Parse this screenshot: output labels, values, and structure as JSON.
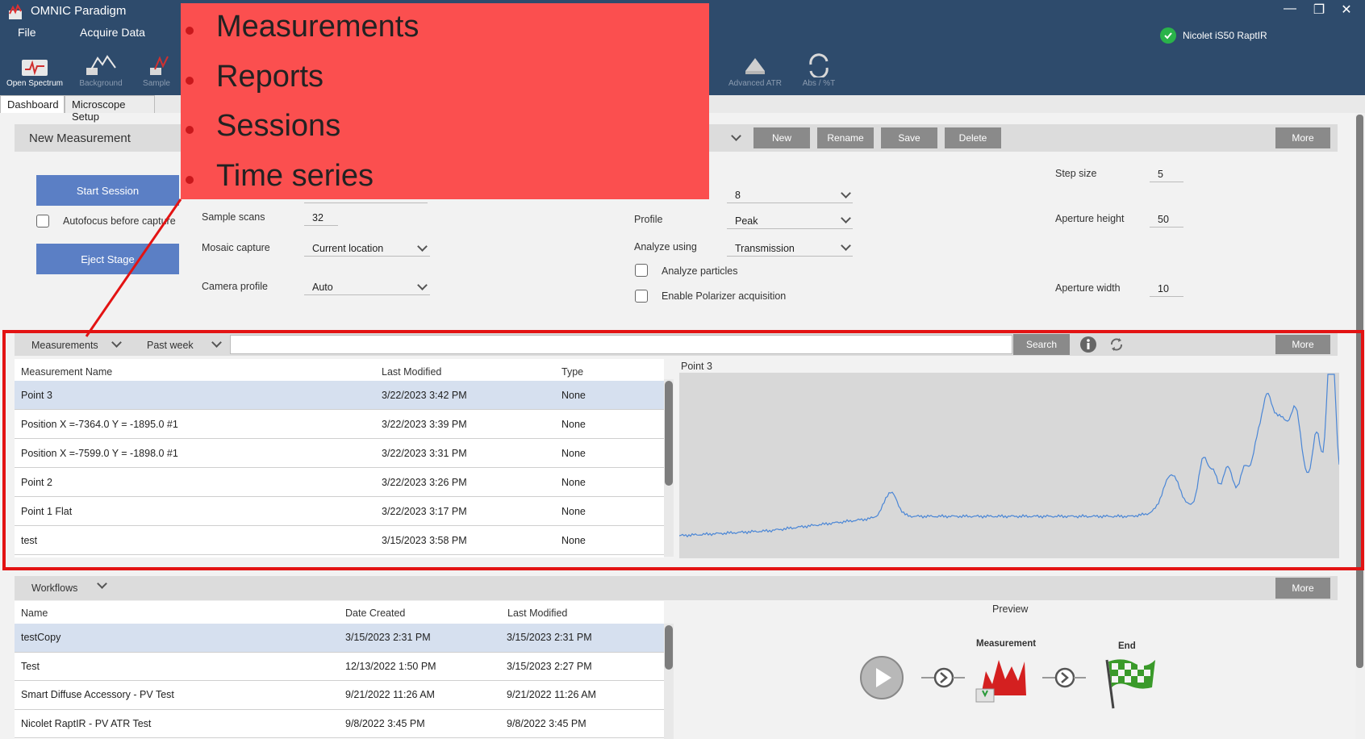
{
  "app": {
    "title": "OMNIC Paradigm"
  },
  "window_controls": {
    "minimize": "—",
    "restore": "❐",
    "close": "✕"
  },
  "menu": {
    "file": "File",
    "acquire": "Acquire Data"
  },
  "instrument": {
    "name": "Nicolet iS50 RaptIR",
    "status_color": "#2ab34a"
  },
  "toolbar": {
    "open_spectrum": "Open Spectrum",
    "background": "Background",
    "sample": "Sample",
    "advanced_atr": "Advanced ATR",
    "abs_t": "Abs / %T"
  },
  "tabs": {
    "dashboard": "Dashboard",
    "microscope": "Microscope Setup"
  },
  "new_measurement": {
    "title": "New Measurement",
    "buttons": {
      "new": "New",
      "rename": "Rename",
      "save": "Save",
      "delete": "Delete",
      "more": "More"
    },
    "start_session": "Start Session",
    "eject_stage": "Eject Stage",
    "autofocus_label": "Autofocus before capture",
    "sample_scans_label": "Sample scans",
    "sample_scans_value": "32",
    "mosaic_label": "Mosaic capture",
    "mosaic_value": "Current location",
    "camera_label": "Camera profile",
    "camera_value": "Auto",
    "top_select_value": "8",
    "profile_label": "Profile",
    "profile_value": "Peak",
    "analyze_label": "Analyze using",
    "analyze_value": "Transmission",
    "analyze_particles_label": "Analyze particles",
    "polarizer_label": "Enable Polarizer acquisition",
    "step_size_label": "Step size",
    "step_size_value": "5",
    "aperture_height_label": "Aperture height",
    "aperture_height_value": "50",
    "aperture_width_label": "Aperture width",
    "aperture_width_value": "10"
  },
  "measurements": {
    "scope_select": "Measurements",
    "time_select": "Past week",
    "search_button": "Search",
    "more": "More",
    "columns": [
      "Measurement Name",
      "Last Modified",
      "Type"
    ],
    "rows": [
      [
        "Point 3",
        "3/22/2023 3:42 PM",
        "None"
      ],
      [
        "Position X =-7364.0 Y = -1895.0 #1",
        "3/22/2023 3:39 PM",
        "None"
      ],
      [
        "Position X =-7599.0 Y = -1898.0 #1",
        "3/22/2023 3:31 PM",
        "None"
      ],
      [
        "Point 2",
        "3/22/2023 3:26 PM",
        "None"
      ],
      [
        "Point 1 Flat",
        "3/22/2023 3:17 PM",
        "None"
      ],
      [
        "test",
        "3/15/2023 3:58 PM",
        "None"
      ]
    ],
    "preview_title": "Point 3",
    "spectrum_color": "#4a86d6"
  },
  "workflows": {
    "select": "Workflows",
    "more": "More",
    "columns": [
      "Name",
      "Date Created",
      "Last Modified"
    ],
    "rows": [
      [
        "testCopy",
        "3/15/2023 2:31 PM",
        "3/15/2023 2:31 PM"
      ],
      [
        "Test",
        "12/13/2022 1:50 PM",
        "3/15/2023 2:27 PM"
      ],
      [
        "Smart Diffuse Accessory - PV Test",
        "9/21/2022 11:26 AM",
        "9/21/2022 11:26 AM"
      ],
      [
        "Nicolet RaptIR - PV ATR Test",
        "9/8/2022 3:45 PM",
        "9/8/2022 3:45 PM"
      ]
    ],
    "preview_title": "Preview",
    "measurement_label": "Measurement",
    "end_label": "End"
  },
  "overlay": {
    "items": [
      "Measurements",
      "Reports",
      "Sessions",
      "Time series"
    ],
    "background_color": "#fb4f4f",
    "highlight_color": "#e31313"
  }
}
